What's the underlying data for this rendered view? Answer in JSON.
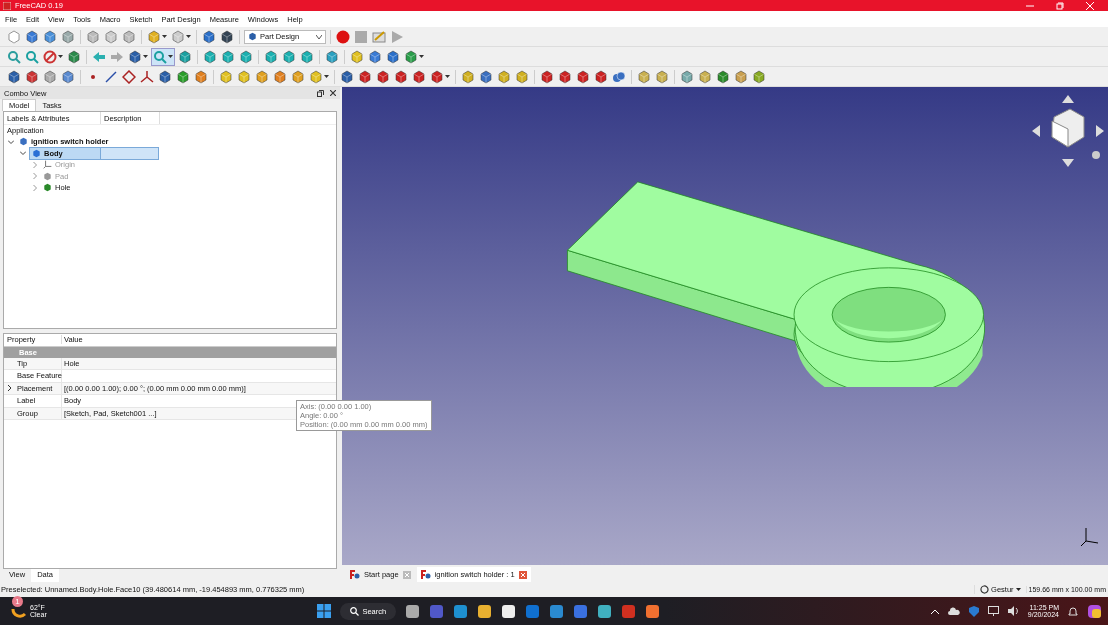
{
  "window": {
    "title": "FreeCAD 0.19"
  },
  "menu": [
    "File",
    "Edit",
    "View",
    "Tools",
    "Macro",
    "Sketch",
    "Part Design",
    "Measure",
    "Windows",
    "Help"
  ],
  "workbench": {
    "value": "Part Design"
  },
  "combo_view": {
    "title": "Combo View",
    "tabs": [
      {
        "label": "Model",
        "selected": true
      },
      {
        "label": "Tasks",
        "selected": false
      }
    ],
    "tree": {
      "columns": [
        "Labels & Attributes",
        "Description"
      ],
      "root_label": "Application",
      "items": [
        {
          "label": "ignition switch holder",
          "bold": true,
          "expanded": true,
          "selected": false,
          "dimmed": false,
          "kind": "document",
          "children": [
            {
              "label": "Body",
              "bold": true,
              "expanded": true,
              "selected": true,
              "dimmed": false,
              "kind": "body",
              "children": [
                {
                  "label": "Origin",
                  "bold": false,
                  "expanded": false,
                  "selected": false,
                  "dimmed": true,
                  "kind": "origin"
                },
                {
                  "label": "Pad",
                  "bold": false,
                  "expanded": false,
                  "selected": false,
                  "dimmed": true,
                  "kind": "pad"
                },
                {
                  "label": "Hole",
                  "bold": false,
                  "expanded": false,
                  "selected": false,
                  "dimmed": false,
                  "kind": "hole"
                }
              ]
            }
          ]
        }
      ]
    }
  },
  "properties": {
    "columns": [
      "Property",
      "Value"
    ],
    "rows": [
      {
        "kind": "group",
        "name": "Base"
      },
      {
        "kind": "prop",
        "name": "Tip",
        "value": "Hole",
        "expandable": false
      },
      {
        "kind": "prop",
        "name": "Base Feature",
        "expandable": false
      },
      {
        "kind": "prop",
        "name": "Placement",
        "value": "[(0.00 0.00 1.00); 0.00 °; (0.00 mm  0.00 mm  0.00 mm)]",
        "expandable": true
      },
      {
        "kind": "prop",
        "name": "Label",
        "value": "Body",
        "expandable": false
      },
      {
        "kind": "prop",
        "name": "Group",
        "value": "[Sketch, Pad, Sketch001 ...]",
        "expandable": false
      }
    ]
  },
  "tooltip": [
    "Axis: (0.00 0.00 1.00)",
    "Angle: 0.00 °",
    "Position: (0.00 mm  0.00 mm  0.00 mm)"
  ],
  "panel_tabs": [
    {
      "label": "View",
      "selected": false
    },
    {
      "label": "Data",
      "selected": true
    }
  ],
  "document_tabs": [
    {
      "label": "Start page",
      "selected": false
    },
    {
      "label": "ignition switch holder : 1",
      "selected": true
    }
  ],
  "status_bar": {
    "message": "Preselected: Unnamed.Body.Hole.Face10 (39.480614 mm, -19.454893 mm, 0.776325 mm)",
    "navigation": "Gestur",
    "dimensions": "159.66 mm x 100.00 mm"
  },
  "taskbar": {
    "weather_badge": "1",
    "temperature": "62°F",
    "condition": "Clear",
    "search": "Search",
    "time": "11:25 PM",
    "date": "9/20/2024"
  }
}
